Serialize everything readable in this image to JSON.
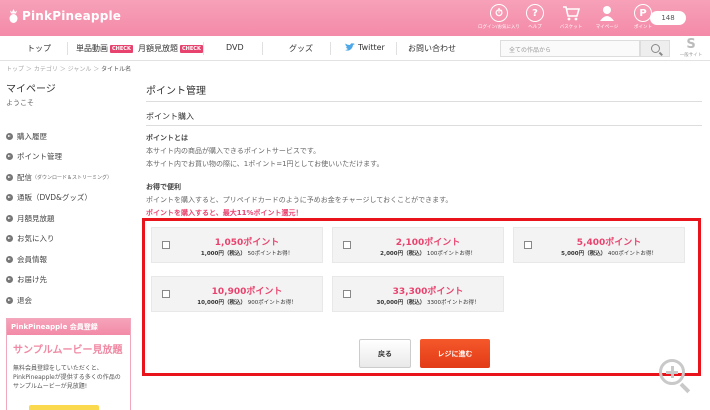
{
  "header": {
    "logo": "PinkPineapple",
    "icons": [
      {
        "icon": "clock-icon",
        "label": "ログイン/お気に入り"
      },
      {
        "icon": "help-icon",
        "label": "ヘルプ"
      },
      {
        "icon": "cart-icon",
        "label": "バスケット"
      },
      {
        "icon": "user-icon",
        "label": "マイページ"
      },
      {
        "icon": "point-icon",
        "label": "ポイント"
      }
    ],
    "points": "148"
  },
  "nav": {
    "top": "トップ",
    "single": "単品動画",
    "single_badge": "CHECK",
    "monthly": "月額見放題",
    "monthly_badge": "CHECK",
    "dvd": "DVD",
    "goods": "グッズ",
    "twitter": "Twitter",
    "contact": "お問い合わせ",
    "search_placeholder": "全ての作品から",
    "sr_label": "一般サイト"
  },
  "breadcrumb": {
    "path": "トップ ＞ カテゴリ ＞ ジャンル ＞ ",
    "current": "タイトル名"
  },
  "sidebar": {
    "title": "マイページ",
    "welcome": "ようこそ",
    "items": [
      {
        "label": "購入履歴",
        "sub": ""
      },
      {
        "label": "ポイント管理",
        "sub": ""
      },
      {
        "label": "配信",
        "sub": "（ダウンロード＆ストリーミング）"
      },
      {
        "label": "通販（DVD&グッズ）",
        "sub": ""
      },
      {
        "label": "月額見放題",
        "sub": ""
      },
      {
        "label": "お気に入り",
        "sub": ""
      },
      {
        "label": "会員情報",
        "sub": ""
      },
      {
        "label": "お届け先",
        "sub": ""
      },
      {
        "label": "退会",
        "sub": ""
      }
    ],
    "promo": {
      "head": "PinkPineapple 会員登録",
      "title": "サンプルムービー見放題",
      "line1": "無料会員登録をしていただくと、",
      "line2": "PinkPineappleが提供する多くの作品の",
      "line3": "サンプルムービーが見放題!"
    }
  },
  "main": {
    "title": "ポイント管理",
    "subtitle": "ポイント購入",
    "about_head": "ポイントとは",
    "about_1": "本サイト内の商品が購入できるポイントサービスです。",
    "about_2": "本サイト内でお買い物の際に、1ポイント=1円としてお使いいただけます。",
    "benefit_head": "お得で便利",
    "benefit_1": "ポイントを購入すると、プリペイドカードのように予めお金をチャージしておくことができます。",
    "benefit_red": "ポイントを購入すると、最大11%ポイント還元！",
    "options": [
      {
        "points": "1,050ポイント",
        "price": "1,000円（税込）",
        "bonus": "50ポイントお得！"
      },
      {
        "points": "2,100ポイント",
        "price": "2,000円（税込）",
        "bonus": "100ポイントお得！"
      },
      {
        "points": "5,400ポイント",
        "price": "5,000円（税込）",
        "bonus": "400ポイントお得！"
      },
      {
        "points": "10,900ポイント",
        "price": "10,000円（税込）",
        "bonus": "900ポイントお得！"
      },
      {
        "points": "33,300ポイント",
        "price": "30,000円（税込）",
        "bonus": "3300ポイントお得！"
      }
    ],
    "back_label": "戻る",
    "checkout_label": "レジに進む"
  },
  "colors": {
    "brand_pink": "#f48aa8",
    "accent_red": "#e8436e",
    "frame_red": "#e8131b",
    "checkout_orange": "#e8461f"
  }
}
